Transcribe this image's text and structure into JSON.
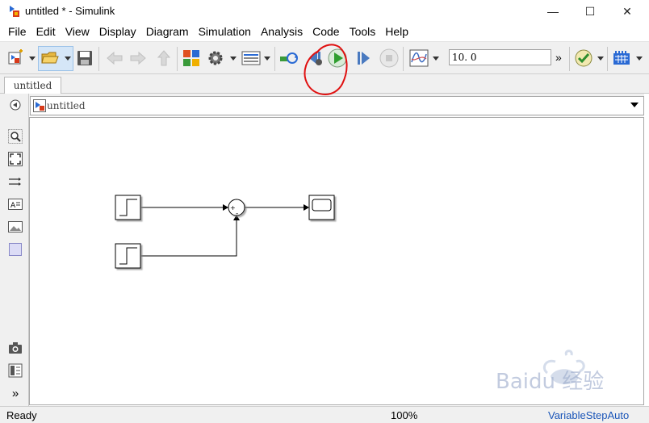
{
  "window": {
    "title": "untitled * - Simulink",
    "minimize": "—",
    "maximize": "☐",
    "close": "✕"
  },
  "menu": [
    "File",
    "Edit",
    "View",
    "Display",
    "Diagram",
    "Simulation",
    "Analysis",
    "Code",
    "Tools",
    "Help"
  ],
  "toolbar": {
    "stop_time": "10. 0",
    "overflow": "»"
  },
  "tab": {
    "label": "untitled"
  },
  "address": {
    "path": "untitled"
  },
  "palette_more": "»",
  "status": {
    "left": "Ready",
    "zoom": "100%",
    "solver": "VariableStepAuto"
  },
  "colors": {
    "run_green": "#2e9e2e",
    "annotation_red": "#e01010",
    "status_link": "#1a55b8"
  },
  "watermark": "Baidu 经验"
}
